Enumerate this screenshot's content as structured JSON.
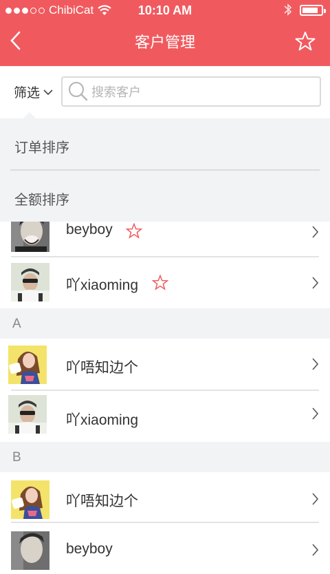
{
  "status_bar": {
    "carrier": "ChibiCat",
    "time": "10:10 AM"
  },
  "nav": {
    "title": "客户管理"
  },
  "search": {
    "filter_label": "筛选",
    "placeholder": "搜索客户"
  },
  "dropdown": {
    "items": [
      {
        "label": "订单排序"
      },
      {
        "label": "全额排序"
      }
    ]
  },
  "list": {
    "rows_top": [
      {
        "name": "beyboy",
        "starred": true,
        "avatar": "avatar-man-laughing"
      },
      {
        "name": "吖xiaoming",
        "starred": true,
        "avatar": "avatar-man-sunglasses"
      }
    ],
    "section_a": {
      "header": "A",
      "rows": [
        {
          "name": "吖唔知边个",
          "starred": false,
          "avatar": "avatar-woman-yellow"
        },
        {
          "name": "吖xiaoming",
          "starred": false,
          "avatar": "avatar-man-sunglasses"
        }
      ]
    },
    "section_b": {
      "header": "B",
      "rows": [
        {
          "name": "吖唔知边个",
          "starred": false,
          "avatar": "avatar-woman-yellow"
        },
        {
          "name": "beyboy",
          "starred": false,
          "avatar": "avatar-man-laughing"
        }
      ]
    }
  },
  "colors": {
    "accent": "#f05a5e",
    "section_bg": "#f2f3f5",
    "star_outline": "#f05a5e"
  }
}
